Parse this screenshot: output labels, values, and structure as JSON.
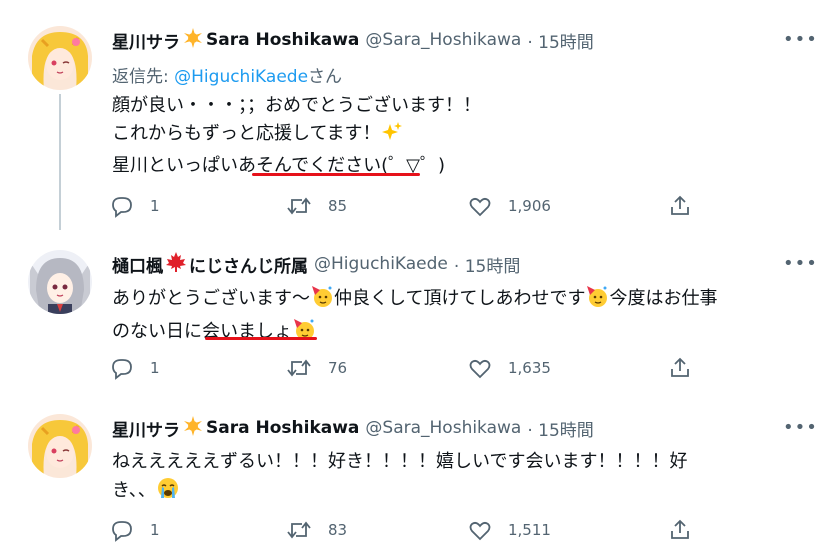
{
  "tweets": [
    {
      "name": "星川サラ",
      "name_en": "Sara Hoshikawa",
      "handle": "@Sara_Hoshikawa",
      "time": "· 15時間",
      "reply_prefix": "返信先: ",
      "reply_handle": "@HiguchiKaede",
      "reply_suffix": "さん",
      "lines": [
        "顔が良い・・・；；おめでとうございます！！",
        "これからもずっと応援してます！",
        "星川といっぱいあそんでください(゜▽゜)"
      ],
      "replies": "1",
      "retweets": "85",
      "likes": "1,906"
    },
    {
      "name": "樋口楓",
      "name_suffix": "にじさんじ所属",
      "handle": "@HiguchiKaede",
      "time": "· 15時間",
      "line1_a": "ありがとうございます〜",
      "line1_b": "仲良くして頂けてしあわせです",
      "line1_c": "今度はお仕事",
      "line2": "のない日に会いましょ",
      "replies": "1",
      "retweets": "76",
      "likes": "1,635"
    },
    {
      "name": "星川サラ",
      "name_en": "Sara Hoshikawa",
      "handle": "@Sara_Hoshikawa",
      "time": "· 15時間",
      "line1": "ねえええええずるい！！！好き！！！！嬉しいです会います！！！！好",
      "line2": "き、、",
      "replies": "1",
      "retweets": "83",
      "likes": "1,511"
    }
  ],
  "colors": {
    "text": "#0f1419",
    "muted": "#536471",
    "link": "#1d9bf0",
    "underline": "#e6111a"
  }
}
